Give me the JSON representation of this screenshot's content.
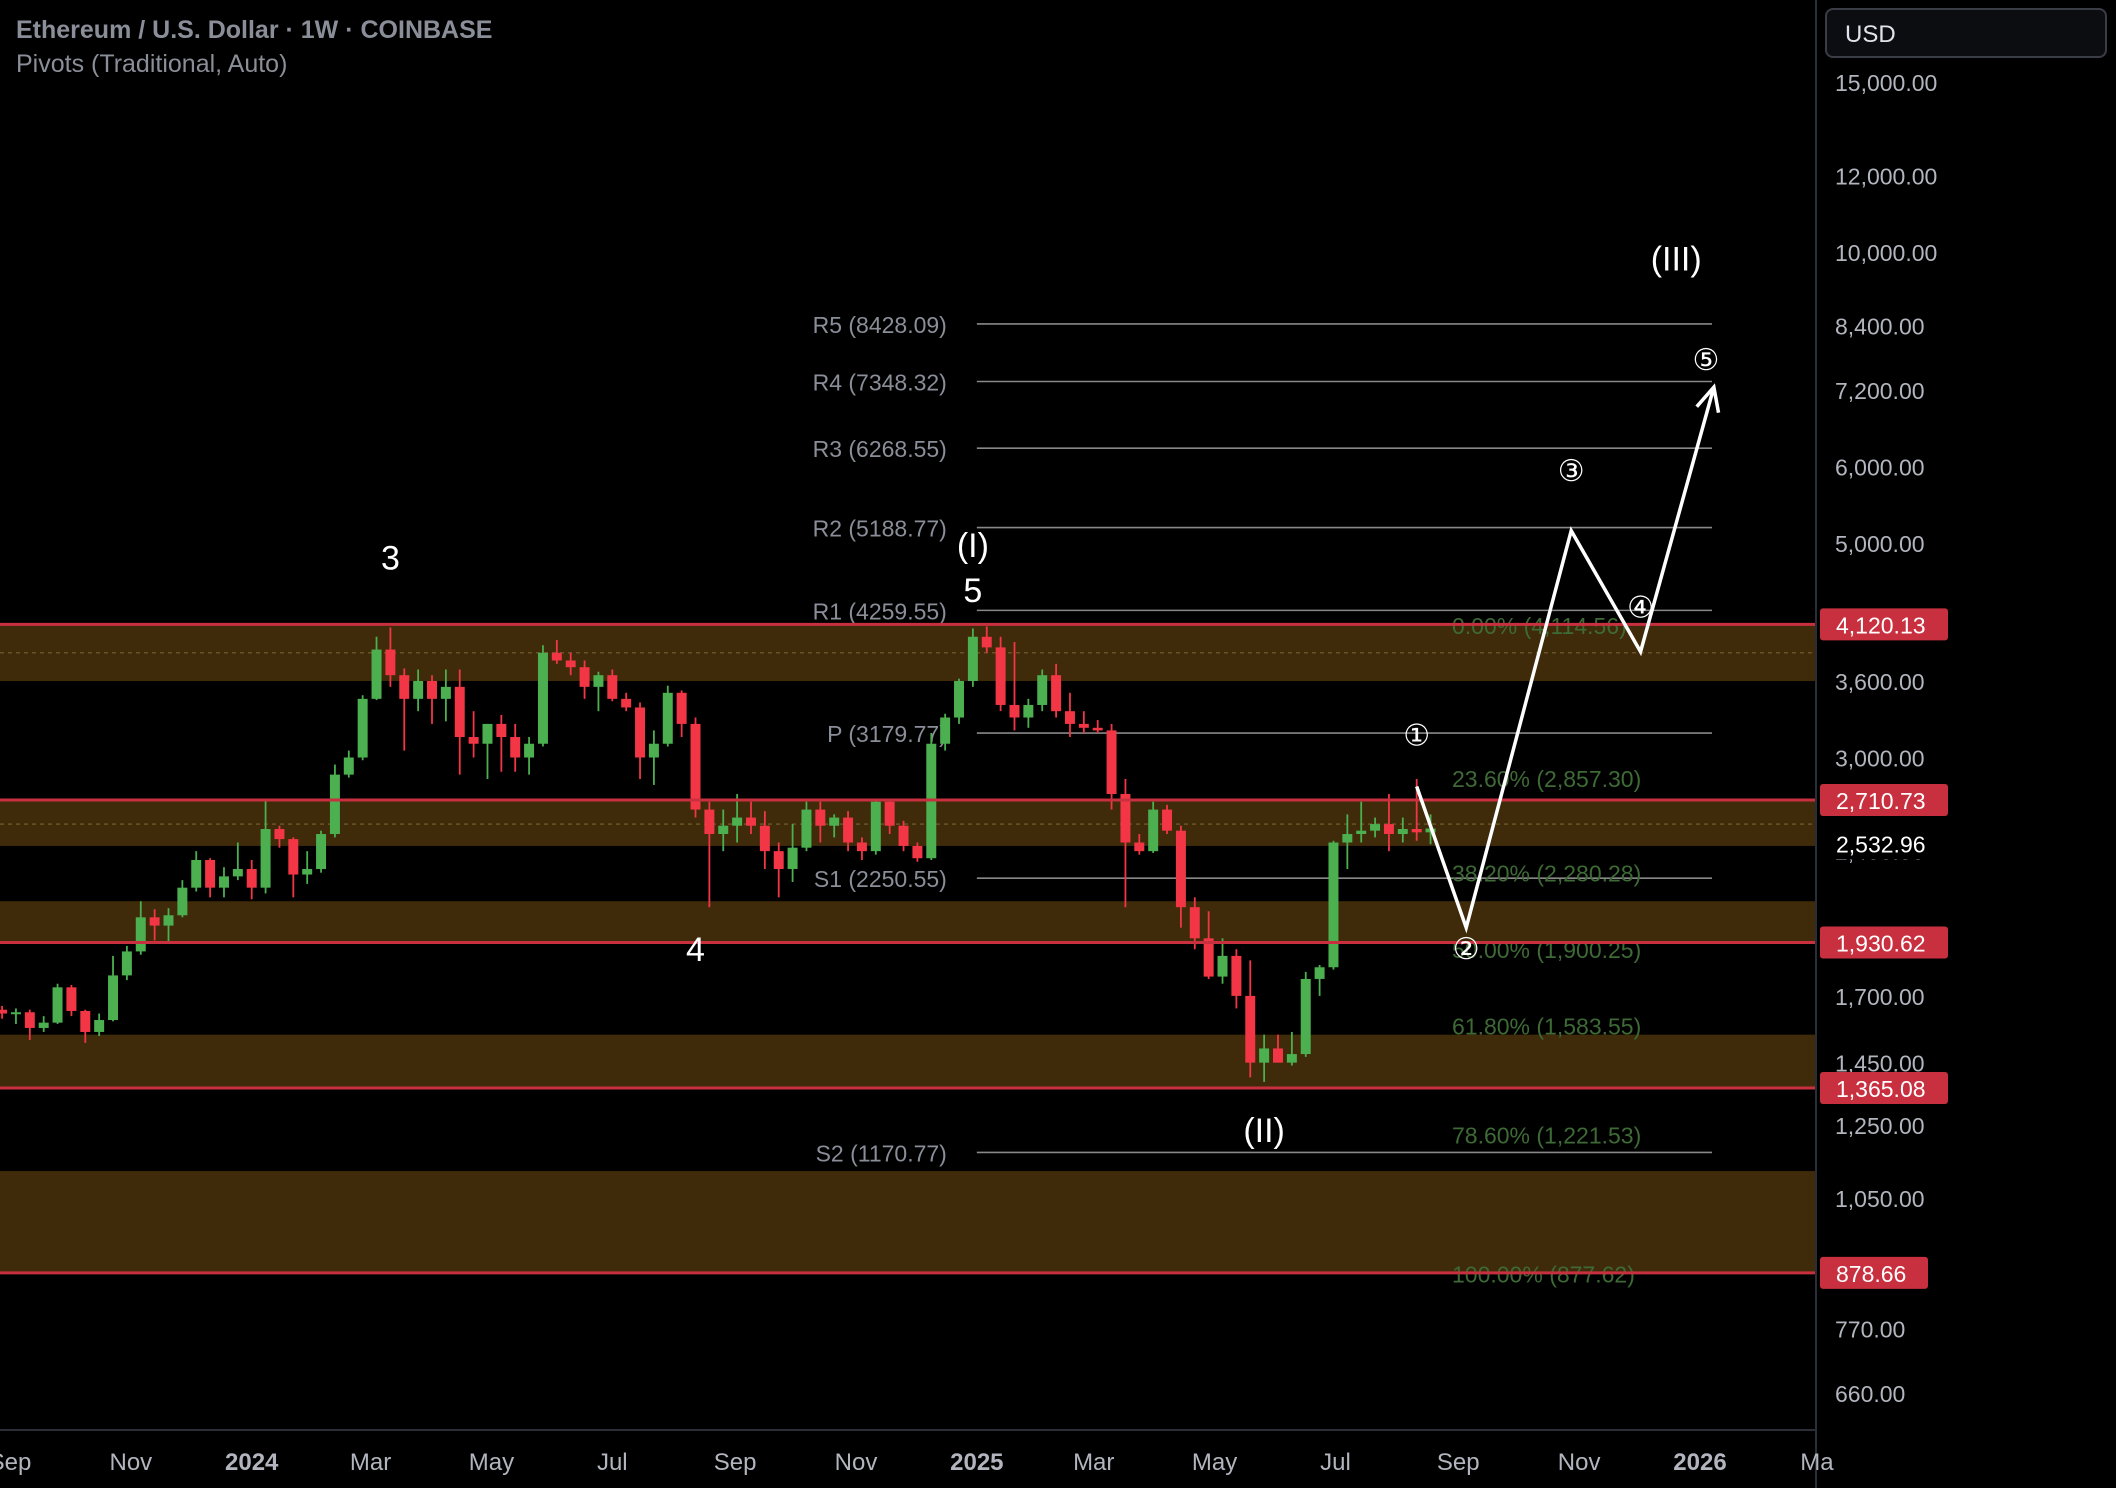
{
  "header": {
    "title": "Ethereum / U.S. Dollar · 1W · COINBASE",
    "subtitle": "Pivots (Traditional, Auto)"
  },
  "currency_button": "USD",
  "chart_data": {
    "type": "candlestick",
    "scale": "log",
    "ylim": [
      610,
      16500
    ],
    "y_ticks": [
      "15,000.00",
      "12,000.00",
      "10,000.00",
      "8,400.00",
      "7,200.00",
      "6,000.00",
      "5,000.00",
      "3,600.00",
      "3,000.00",
      "2,400.00",
      "1,700.00",
      "1,450.00",
      "1,250.00",
      "1,050.00",
      "770.00",
      "660.00"
    ],
    "y_tick_values": [
      15000,
      12000,
      10000,
      8400,
      7200,
      6000,
      5000,
      3600,
      3000,
      2400,
      1700,
      1450,
      1250,
      1050,
      770,
      660
    ],
    "x_ticks": [
      "Sep",
      "Nov",
      "2024",
      "Mar",
      "May",
      "Jul",
      "Sep",
      "Nov",
      "2025",
      "Mar",
      "May",
      "Jul",
      "Sep",
      "Nov",
      "2026",
      "Ma"
    ],
    "x_tick_dates": [
      "2023-09-01",
      "2023-11-01",
      "2024-01-01",
      "2024-03-01",
      "2024-05-01",
      "2024-07-01",
      "2024-09-01",
      "2024-11-01",
      "2025-01-01",
      "2025-03-01",
      "2025-05-01",
      "2025-07-01",
      "2025-09-01",
      "2025-11-01",
      "2026-01-01",
      "2026-03-01"
    ],
    "x_tick_bold": [
      false,
      false,
      true,
      false,
      false,
      false,
      false,
      false,
      true,
      false,
      false,
      false,
      false,
      false,
      true,
      false
    ],
    "colors": {
      "up": "#4caf50",
      "down": "#f23645",
      "zone": "#3f2a09",
      "zone_line": "#c8303f",
      "pivot_line": "#888888",
      "fib_text": "#3e6a36",
      "price_badge": "#c8303f",
      "current_badge": "#000000"
    },
    "candles": [
      {
        "d": "2023-08-28",
        "o": 1645,
        "h": 1660,
        "l": 1610,
        "c": 1630
      },
      {
        "d": "2023-09-04",
        "o": 1630,
        "h": 1650,
        "l": 1590,
        "c": 1635
      },
      {
        "d": "2023-09-11",
        "o": 1635,
        "h": 1645,
        "l": 1530,
        "c": 1575
      },
      {
        "d": "2023-09-18",
        "o": 1575,
        "h": 1620,
        "l": 1560,
        "c": 1595
      },
      {
        "d": "2023-09-25",
        "o": 1595,
        "h": 1750,
        "l": 1590,
        "c": 1735
      },
      {
        "d": "2023-10-02",
        "o": 1735,
        "h": 1745,
        "l": 1620,
        "c": 1640
      },
      {
        "d": "2023-10-09",
        "o": 1640,
        "h": 1645,
        "l": 1520,
        "c": 1560
      },
      {
        "d": "2023-10-16",
        "o": 1560,
        "h": 1630,
        "l": 1545,
        "c": 1605
      },
      {
        "d": "2023-10-23",
        "o": 1605,
        "h": 1870,
        "l": 1600,
        "c": 1785
      },
      {
        "d": "2023-10-30",
        "o": 1785,
        "h": 1915,
        "l": 1765,
        "c": 1890
      },
      {
        "d": "2023-11-06",
        "o": 1890,
        "h": 2130,
        "l": 1875,
        "c": 2050
      },
      {
        "d": "2023-11-13",
        "o": 2050,
        "h": 2090,
        "l": 1940,
        "c": 2010
      },
      {
        "d": "2023-11-20",
        "o": 2010,
        "h": 2095,
        "l": 1930,
        "c": 2060
      },
      {
        "d": "2023-11-27",
        "o": 2060,
        "h": 2240,
        "l": 2050,
        "c": 2200
      },
      {
        "d": "2023-12-04",
        "o": 2200,
        "h": 2400,
        "l": 2180,
        "c": 2350
      },
      {
        "d": "2023-12-11",
        "o": 2350,
        "h": 2360,
        "l": 2150,
        "c": 2200
      },
      {
        "d": "2023-12-18",
        "o": 2200,
        "h": 2310,
        "l": 2150,
        "c": 2260
      },
      {
        "d": "2023-12-25",
        "o": 2260,
        "h": 2450,
        "l": 2240,
        "c": 2300
      },
      {
        "d": "2024-01-01",
        "o": 2300,
        "h": 2350,
        "l": 2140,
        "c": 2200
      },
      {
        "d": "2024-01-08",
        "o": 2200,
        "h": 2720,
        "l": 2170,
        "c": 2530
      },
      {
        "d": "2024-01-15",
        "o": 2530,
        "h": 2550,
        "l": 2420,
        "c": 2470
      },
      {
        "d": "2024-01-22",
        "o": 2470,
        "h": 2480,
        "l": 2150,
        "c": 2270
      },
      {
        "d": "2024-01-29",
        "o": 2270,
        "h": 2400,
        "l": 2220,
        "c": 2300
      },
      {
        "d": "2024-02-05",
        "o": 2300,
        "h": 2520,
        "l": 2280,
        "c": 2500
      },
      {
        "d": "2024-02-12",
        "o": 2500,
        "h": 2950,
        "l": 2480,
        "c": 2880
      },
      {
        "d": "2024-02-19",
        "o": 2880,
        "h": 3050,
        "l": 2860,
        "c": 3000
      },
      {
        "d": "2024-02-26",
        "o": 3000,
        "h": 3480,
        "l": 2980,
        "c": 3450
      },
      {
        "d": "2024-03-04",
        "o": 3450,
        "h": 4000,
        "l": 3440,
        "c": 3880
      },
      {
        "d": "2024-03-11",
        "o": 3880,
        "h": 4090,
        "l": 3550,
        "c": 3650
      },
      {
        "d": "2024-03-18",
        "o": 3650,
        "h": 3710,
        "l": 3050,
        "c": 3450
      },
      {
        "d": "2024-03-25",
        "o": 3450,
        "h": 3700,
        "l": 3350,
        "c": 3600
      },
      {
        "d": "2024-04-01",
        "o": 3600,
        "h": 3650,
        "l": 3250,
        "c": 3450
      },
      {
        "d": "2024-04-08",
        "o": 3450,
        "h": 3700,
        "l": 3270,
        "c": 3550
      },
      {
        "d": "2024-04-15",
        "o": 3550,
        "h": 3700,
        "l": 2880,
        "c": 3150
      },
      {
        "d": "2024-04-22",
        "o": 3150,
        "h": 3350,
        "l": 3000,
        "c": 3100
      },
      {
        "d": "2024-04-29",
        "o": 3100,
        "h": 3250,
        "l": 2850,
        "c": 3250
      },
      {
        "d": "2024-05-06",
        "o": 3250,
        "h": 3320,
        "l": 2900,
        "c": 3150
      },
      {
        "d": "2024-05-13",
        "o": 3150,
        "h": 3250,
        "l": 2900,
        "c": 3000
      },
      {
        "d": "2024-05-20",
        "o": 3000,
        "h": 3150,
        "l": 2880,
        "c": 3100
      },
      {
        "d": "2024-05-27",
        "o": 3100,
        "h": 3920,
        "l": 3080,
        "c": 3850
      },
      {
        "d": "2024-06-03",
        "o": 3850,
        "h": 3970,
        "l": 3750,
        "c": 3780
      },
      {
        "d": "2024-06-10",
        "o": 3780,
        "h": 3850,
        "l": 3650,
        "c": 3720
      },
      {
        "d": "2024-06-17",
        "o": 3720,
        "h": 3780,
        "l": 3450,
        "c": 3550
      },
      {
        "d": "2024-06-24",
        "o": 3550,
        "h": 3680,
        "l": 3350,
        "c": 3650
      },
      {
        "d": "2024-07-01",
        "o": 3650,
        "h": 3700,
        "l": 3430,
        "c": 3450
      },
      {
        "d": "2024-07-08",
        "o": 3450,
        "h": 3500,
        "l": 3350,
        "c": 3380
      },
      {
        "d": "2024-07-15",
        "o": 3380,
        "h": 3420,
        "l": 2850,
        "c": 3000
      },
      {
        "d": "2024-07-22",
        "o": 3000,
        "h": 3200,
        "l": 2810,
        "c": 3100
      },
      {
        "d": "2024-07-29",
        "o": 3100,
        "h": 3560,
        "l": 3080,
        "c": 3500
      },
      {
        "d": "2024-08-05",
        "o": 3500,
        "h": 3520,
        "l": 3150,
        "c": 3250
      },
      {
        "d": "2024-08-12",
        "o": 3250,
        "h": 3300,
        "l": 2600,
        "c": 2650
      },
      {
        "d": "2024-08-19",
        "o": 2650,
        "h": 2700,
        "l": 2100,
        "c": 2500
      },
      {
        "d": "2024-08-26",
        "o": 2500,
        "h": 2650,
        "l": 2400,
        "c": 2550
      },
      {
        "d": "2024-09-02",
        "o": 2550,
        "h": 2750,
        "l": 2450,
        "c": 2600
      },
      {
        "d": "2024-09-09",
        "o": 2600,
        "h": 2700,
        "l": 2500,
        "c": 2550
      },
      {
        "d": "2024-09-16",
        "o": 2550,
        "h": 2640,
        "l": 2300,
        "c": 2400
      },
      {
        "d": "2024-09-23",
        "o": 2400,
        "h": 2450,
        "l": 2150,
        "c": 2300
      },
      {
        "d": "2024-09-30",
        "o": 2300,
        "h": 2560,
        "l": 2230,
        "c": 2420
      },
      {
        "d": "2024-10-07",
        "o": 2420,
        "h": 2700,
        "l": 2400,
        "c": 2650
      },
      {
        "d": "2024-10-14",
        "o": 2650,
        "h": 2700,
        "l": 2450,
        "c": 2550
      },
      {
        "d": "2024-10-21",
        "o": 2550,
        "h": 2620,
        "l": 2480,
        "c": 2600
      },
      {
        "d": "2024-10-28",
        "o": 2600,
        "h": 2640,
        "l": 2400,
        "c": 2450
      },
      {
        "d": "2024-11-04",
        "o": 2450,
        "h": 2480,
        "l": 2350,
        "c": 2400
      },
      {
        "d": "2024-11-11",
        "o": 2400,
        "h": 2720,
        "l": 2380,
        "c": 2700
      },
      {
        "d": "2024-11-18",
        "o": 2700,
        "h": 2720,
        "l": 2500,
        "c": 2550
      },
      {
        "d": "2024-11-25",
        "o": 2550,
        "h": 2580,
        "l": 2400,
        "c": 2430
      },
      {
        "d": "2024-12-02",
        "o": 2430,
        "h": 2450,
        "l": 2340,
        "c": 2360
      },
      {
        "d": "2024-12-09",
        "o": 2360,
        "h": 3180,
        "l": 2350,
        "c": 3100
      },
      {
        "d": "2024-12-16",
        "o": 3100,
        "h": 3330,
        "l": 3050,
        "c": 3300
      },
      {
        "d": "2024-12-23",
        "o": 3300,
        "h": 3620,
        "l": 3250,
        "c": 3600
      },
      {
        "d": "2024-12-30",
        "o": 3600,
        "h": 4080,
        "l": 3550,
        "c": 4000
      },
      {
        "d": "2025-01-06",
        "o": 4000,
        "h": 4100,
        "l": 3850,
        "c": 3900
      },
      {
        "d": "2025-01-13",
        "o": 3900,
        "h": 4000,
        "l": 3350,
        "c": 3400
      },
      {
        "d": "2025-01-20",
        "o": 3400,
        "h": 3950,
        "l": 3200,
        "c": 3300
      },
      {
        "d": "2025-01-27",
        "o": 3300,
        "h": 3450,
        "l": 3220,
        "c": 3400
      },
      {
        "d": "2025-02-03",
        "o": 3400,
        "h": 3700,
        "l": 3350,
        "c": 3650
      },
      {
        "d": "2025-02-10",
        "o": 3650,
        "h": 3750,
        "l": 3300,
        "c": 3350
      },
      {
        "d": "2025-02-17",
        "o": 3350,
        "h": 3500,
        "l": 3150,
        "c": 3250
      },
      {
        "d": "2025-02-24",
        "o": 3250,
        "h": 3350,
        "l": 3180,
        "c": 3220
      },
      {
        "d": "2025-03-03",
        "o": 3220,
        "h": 3280,
        "l": 3180,
        "c": 3200
      },
      {
        "d": "2025-03-10",
        "o": 3200,
        "h": 3250,
        "l": 2650,
        "c": 2750
      },
      {
        "d": "2025-03-17",
        "o": 2750,
        "h": 2850,
        "l": 2100,
        "c": 2450
      },
      {
        "d": "2025-03-24",
        "o": 2450,
        "h": 2500,
        "l": 2380,
        "c": 2400
      },
      {
        "d": "2025-03-31",
        "o": 2400,
        "h": 2700,
        "l": 2390,
        "c": 2650
      },
      {
        "d": "2025-04-07",
        "o": 2650,
        "h": 2680,
        "l": 2500,
        "c": 2520
      },
      {
        "d": "2025-04-14",
        "o": 2520,
        "h": 2550,
        "l": 2000,
        "c": 2100
      },
      {
        "d": "2025-04-21",
        "o": 2100,
        "h": 2150,
        "l": 1900,
        "c": 1950
      },
      {
        "d": "2025-04-28",
        "o": 1950,
        "h": 2080,
        "l": 1770,
        "c": 1780
      },
      {
        "d": "2025-05-05",
        "o": 1780,
        "h": 1950,
        "l": 1750,
        "c": 1870
      },
      {
        "d": "2025-05-12",
        "o": 1870,
        "h": 1900,
        "l": 1650,
        "c": 1700
      },
      {
        "d": "2025-05-19",
        "o": 1700,
        "h": 1850,
        "l": 1400,
        "c": 1450
      },
      {
        "d": "2025-05-26",
        "o": 1450,
        "h": 1550,
        "l": 1385,
        "c": 1500
      },
      {
        "d": "2025-06-02",
        "o": 1500,
        "h": 1550,
        "l": 1450,
        "c": 1450
      },
      {
        "d": "2025-06-09",
        "o": 1450,
        "h": 1560,
        "l": 1440,
        "c": 1480
      },
      {
        "d": "2025-06-16",
        "o": 1480,
        "h": 1800,
        "l": 1470,
        "c": 1770
      },
      {
        "d": "2025-06-23",
        "o": 1770,
        "h": 1830,
        "l": 1700,
        "c": 1820
      },
      {
        "d": "2025-06-30",
        "o": 1820,
        "h": 2460,
        "l": 1810,
        "c": 2450
      },
      {
        "d": "2025-07-07",
        "o": 2450,
        "h": 2620,
        "l": 2300,
        "c": 2500
      },
      {
        "d": "2025-07-14",
        "o": 2500,
        "h": 2700,
        "l": 2450,
        "c": 2520
      },
      {
        "d": "2025-07-21",
        "o": 2520,
        "h": 2600,
        "l": 2480,
        "c": 2560
      },
      {
        "d": "2025-07-28",
        "o": 2560,
        "h": 2750,
        "l": 2400,
        "c": 2500
      },
      {
        "d": "2025-08-04",
        "o": 2500,
        "h": 2600,
        "l": 2450,
        "c": 2530
      },
      {
        "d": "2025-08-11",
        "o": 2530,
        "h": 2850,
        "l": 2460,
        "c": 2510
      },
      {
        "d": "2025-08-18",
        "o": 2510,
        "h": 2620,
        "l": 2440,
        "c": 2533
      }
    ],
    "zones": [
      {
        "low": 3600,
        "high": 4120.13
      },
      {
        "low": 2430,
        "high": 2710.73
      },
      {
        "low": 1930.62,
        "high": 2130
      },
      {
        "low": 1365.08,
        "high": 1550
      },
      {
        "low": 878.66,
        "high": 1120
      }
    ],
    "price_badges": [
      "4,120.13",
      "2,710.73",
      "1,930.62",
      "1,365.08",
      "878.66"
    ],
    "price_badge_values": [
      4120.13,
      2710.73,
      1930.62,
      1365.08,
      878.66
    ],
    "current_price": "2,532.96",
    "current_price_value": 2532.96,
    "pivots": [
      {
        "label": "R5 (8428.09)",
        "value": 8428.09
      },
      {
        "label": "R4 (7348.32)",
        "value": 7348.32
      },
      {
        "label": "R3 (6268.55)",
        "value": 6268.55
      },
      {
        "label": "R2 (5188.77)",
        "value": 5188.77
      },
      {
        "label": "R1 (4259.55)",
        "value": 4259.55
      },
      {
        "label": "P (3179.77)",
        "value": 3179.77
      },
      {
        "label": "S1 (2250.55)",
        "value": 2250.55
      },
      {
        "label": "S2 (1170.77)",
        "value": 1170.77
      }
    ],
    "pivot_range": [
      "2025-01-01",
      "2025-12-31"
    ],
    "fib_levels": [
      {
        "label": "0.00% (4,114.56)",
        "value": 4114.56
      },
      {
        "label": "23.60% (2,857.30)",
        "value": 2857.3
      },
      {
        "label": "38.20% (2,280.28)",
        "value": 2280.28
      },
      {
        "label": "50.00% (1,900.25)",
        "value": 1900.25
      },
      {
        "label": "61.80% (1,583.55)",
        "value": 1583.55
      },
      {
        "label": "78.60% (1,221.53)",
        "value": 1221.53
      },
      {
        "label": "100.00% (877.62)",
        "value": 877.62
      }
    ],
    "wave_labels": [
      {
        "text": "3",
        "d": "2024-03-11",
        "v": 4830
      },
      {
        "text": "4",
        "d": "2024-08-12",
        "v": 1900
      },
      {
        "text": "5",
        "d": "2024-12-30",
        "v": 4470
      },
      {
        "text": "(I)",
        "d": "2024-12-30",
        "v": 4980
      },
      {
        "text": "(II)",
        "d": "2025-05-26",
        "v": 1235
      },
      {
        "text": "(III)",
        "d": "2025-12-20",
        "v": 9850
      }
    ],
    "projection": {
      "labels": [
        "①",
        "②",
        "③",
        "④",
        "⑤"
      ],
      "path": [
        {
          "d": "2025-08-11",
          "v": 2800
        },
        {
          "d": "2025-09-05",
          "v": 2000
        },
        {
          "d": "2025-10-28",
          "v": 5150
        },
        {
          "d": "2025-12-02",
          "v": 3860
        },
        {
          "d": "2026-01-08",
          "v": 7250
        }
      ],
      "label_points": [
        {
          "d": "2025-08-11",
          "v": 3170
        },
        {
          "d": "2025-09-05",
          "v": 1905
        },
        {
          "d": "2025-10-28",
          "v": 5950
        },
        {
          "d": "2025-12-02",
          "v": 4300
        },
        {
          "d": "2026-01-04",
          "v": 7750
        }
      ]
    }
  }
}
